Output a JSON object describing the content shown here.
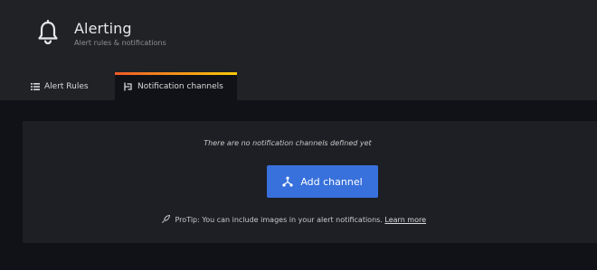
{
  "header": {
    "title": "Alerting",
    "subtitle": "Alert rules & notifications",
    "icon": "bell-icon"
  },
  "tabs": [
    {
      "label": "Alert Rules",
      "icon": "list-icon",
      "active": false
    },
    {
      "label": "Notification channels",
      "icon": "channels-icon",
      "active": true
    }
  ],
  "empty_state": {
    "message": "There are no notification channels defined yet",
    "button_label": "Add channel",
    "button_icon": "channel-add-icon",
    "protip": "ProTip: You can include images in your alert notifications.",
    "protip_icon": "rocket-icon",
    "learn_more": "Learn more"
  },
  "colors": {
    "background": "#111217",
    "header_bg": "#202226",
    "panel_bg": "#1d1f24",
    "primary_button": "#3871dc",
    "active_tab_gradient_start": "#f05a28",
    "active_tab_gradient_end": "#fbca0a"
  }
}
